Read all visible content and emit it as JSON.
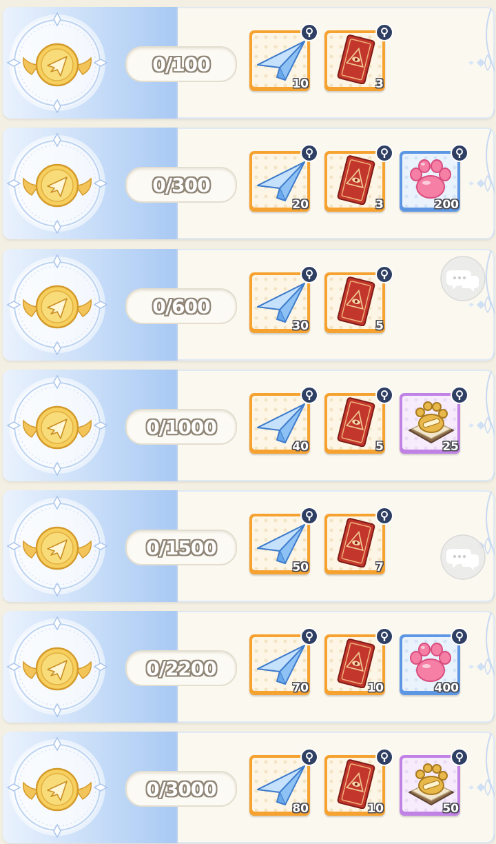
{
  "tiers": [
    {
      "progress": "0/100",
      "rewards": [
        {
          "kind": "paper-plane",
          "qty": "10",
          "frame": "orange"
        },
        {
          "kind": "tarot-card",
          "qty": "3",
          "frame": "orange"
        }
      ]
    },
    {
      "progress": "0/300",
      "rewards": [
        {
          "kind": "paper-plane",
          "qty": "20",
          "frame": "orange"
        },
        {
          "kind": "tarot-card",
          "qty": "3",
          "frame": "orange"
        },
        {
          "kind": "paw-jelly",
          "qty": "200",
          "frame": "blue"
        }
      ]
    },
    {
      "progress": "0/600",
      "rewards": [
        {
          "kind": "paper-plane",
          "qty": "30",
          "frame": "orange"
        },
        {
          "kind": "tarot-card",
          "qty": "5",
          "frame": "orange"
        }
      ]
    },
    {
      "progress": "0/1000",
      "rewards": [
        {
          "kind": "paper-plane",
          "qty": "40",
          "frame": "orange"
        },
        {
          "kind": "tarot-card",
          "qty": "5",
          "frame": "orange"
        },
        {
          "kind": "paw-cookie",
          "qty": "25",
          "frame": "purple"
        }
      ]
    },
    {
      "progress": "0/1500",
      "rewards": [
        {
          "kind": "paper-plane",
          "qty": "50",
          "frame": "orange"
        },
        {
          "kind": "tarot-card",
          "qty": "7",
          "frame": "orange"
        }
      ]
    },
    {
      "progress": "0/2200",
      "rewards": [
        {
          "kind": "paper-plane",
          "qty": "70",
          "frame": "orange"
        },
        {
          "kind": "tarot-card",
          "qty": "10",
          "frame": "orange"
        },
        {
          "kind": "paw-jelly",
          "qty": "400",
          "frame": "blue"
        }
      ]
    },
    {
      "progress": "0/3000",
      "rewards": [
        {
          "kind": "paper-plane",
          "qty": "80",
          "frame": "orange"
        },
        {
          "kind": "tarot-card",
          "qty": "10",
          "frame": "orange"
        },
        {
          "kind": "paw-cookie",
          "qty": "50",
          "frame": "purple"
        }
      ]
    }
  ],
  "icons": {
    "medal": "gold-paper-plane-medal-icon",
    "lock": "lock-badge-icon",
    "chat": "chat-bubble-icon"
  },
  "colors": {
    "frame_orange": "#f6a231",
    "frame_blue": "#5d97e4",
    "frame_purple": "#c182e6",
    "panel_blue": "#a9c9f3",
    "counter_outline": "#8f8577"
  }
}
